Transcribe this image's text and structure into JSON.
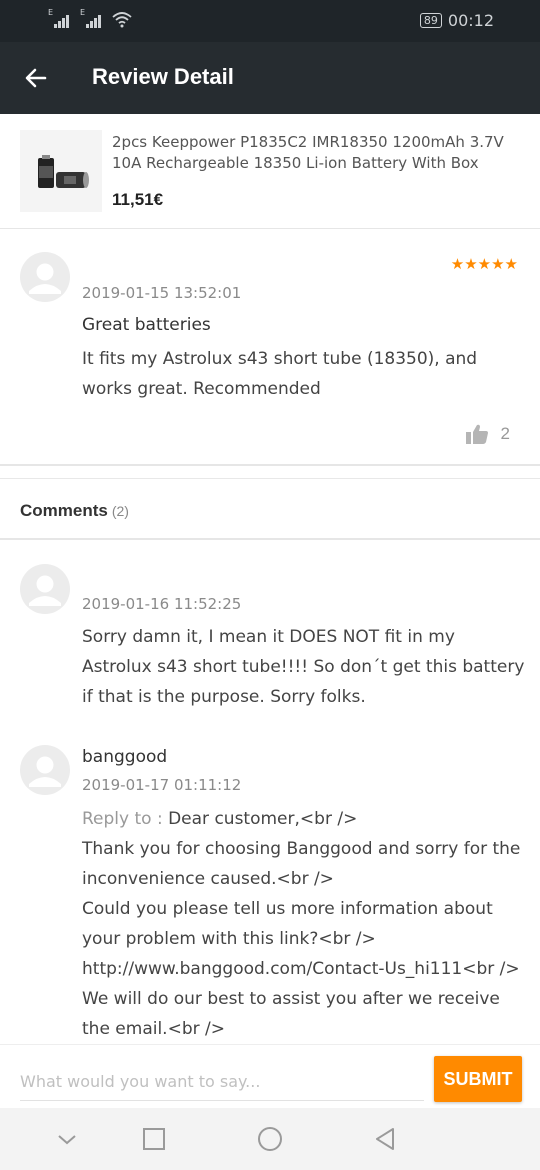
{
  "status_bar": {
    "battery": "89",
    "time": "00:12",
    "network_label": "E",
    "icons": [
      "signal-icon",
      "signal-icon",
      "wifi-icon",
      "battery-icon"
    ]
  },
  "app_bar": {
    "title": "Review Detail",
    "back_icon": "arrow-left-icon"
  },
  "product": {
    "name": "2pcs Keeppower P1835C2 IMR18350 1200mAh 3.7V 10A Rechargeable 18350 Li-ion Battery With Box",
    "price": "11,51€"
  },
  "review": {
    "rating": 5,
    "stars": "★★★★★",
    "date": "2019-01-15 13:52:01",
    "title": "Great batteries",
    "body": "It fits my Astrolux s43 short tube (18350), and works great. Recommended",
    "likes": "2"
  },
  "comments_section": {
    "label": "Comments",
    "count": "(2)"
  },
  "comments": [
    {
      "date": "2019-01-16 11:52:25",
      "text": "Sorry damn it, I mean it DOES NOT fit in my Astrolux s43 short tube!!!! So don´t get this battery if that is the purpose. Sorry folks."
    },
    {
      "username": "banggood",
      "date": "2019-01-17 01:11:12",
      "reply_prefix": "Reply to : ",
      "line1": "Dear customer,<br />",
      "line2": "Thank you for choosing Banggood and sorry for the inconvenience caused.<br />",
      "line3": "Could you please tell us more information about your problem with this link?<br />",
      "line4": "http://www.banggood.com/Contact-Us_hi111<br />",
      "line5": "We will do our best to assist you after we receive the email.<br />"
    }
  ],
  "input": {
    "placeholder": "What would you want to say...",
    "submit_label": "SUBMIT"
  },
  "colors": {
    "accent": "#ff8a00",
    "app_bar": "#262c30",
    "status_bar": "#1f2529"
  },
  "nav_bar": {
    "icons": [
      "chevron-down-icon",
      "recents-square-icon",
      "home-circle-icon",
      "back-triangle-icon"
    ]
  }
}
